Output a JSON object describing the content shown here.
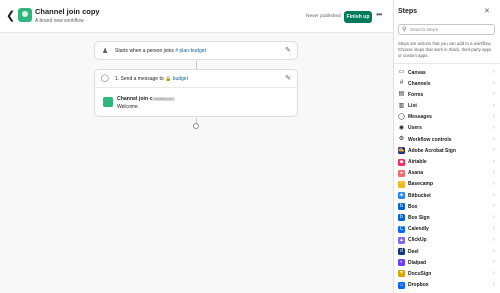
{
  "header": {
    "back_glyph": "❮",
    "title": "Channel join copy",
    "subtitle": "A brand new workflow",
    "status": "Never published",
    "finish_label": "Finish up",
    "more_glyph": "•••"
  },
  "workflow": {
    "trigger_text": "Starts when a person joins",
    "trigger_channel": "# plan-budget",
    "step_text": "1. Send a message to",
    "step_channel": "🔒 budget",
    "message": {
      "name": "Channel join copy",
      "badge": "WORKFLOW",
      "body": "Welcome"
    }
  },
  "panel": {
    "title": "Steps",
    "close_glyph": "✕",
    "search_placeholder": "Search steps",
    "description": "Steps are actions that you can add to a workflow. Choose steps that work in Slack, third-party apps or custom apps.",
    "items": [
      {
        "label": "Canvas",
        "icon": "canvas-icon",
        "glyph": "▭",
        "color": "",
        "outline": true
      },
      {
        "label": "Channels",
        "icon": "hash-icon",
        "glyph": "#",
        "color": "",
        "outline": true
      },
      {
        "label": "Forms",
        "icon": "form-icon",
        "glyph": "▤",
        "color": "",
        "outline": true
      },
      {
        "label": "List",
        "icon": "list-icon",
        "glyph": "▥",
        "color": "",
        "outline": true
      },
      {
        "label": "Messages",
        "icon": "message-icon",
        "glyph": "◯",
        "color": "",
        "outline": true
      },
      {
        "label": "Users",
        "icon": "user-icon",
        "glyph": "◉",
        "color": "",
        "outline": true
      },
      {
        "label": "Workflow controls",
        "icon": "workflow-icon",
        "glyph": "⚙",
        "color": "",
        "outline": true
      },
      {
        "label": "Adobe Acrobat Sign",
        "icon": "adobe-sign-icon",
        "glyph": "✍",
        "color": "#2d2d8c",
        "outline": false
      },
      {
        "label": "Airtable",
        "icon": "airtable-icon",
        "glyph": "◆",
        "color": "#f82b60",
        "outline": false
      },
      {
        "label": "Asana",
        "icon": "asana-icon",
        "glyph": "●",
        "color": "#f06a6a",
        "outline": false
      },
      {
        "label": "Basecamp",
        "icon": "basecamp-icon",
        "glyph": "◠",
        "color": "#e9b821",
        "outline": false
      },
      {
        "label": "Bitbucket",
        "icon": "bitbucket-icon",
        "glyph": "◈",
        "color": "#2684ff",
        "outline": false
      },
      {
        "label": "Box",
        "icon": "box-icon",
        "glyph": "b",
        "color": "#0061d5",
        "outline": false
      },
      {
        "label": "Box Sign",
        "icon": "box-sign-icon",
        "glyph": "b",
        "color": "#0061d5",
        "outline": false
      },
      {
        "label": "Calendly",
        "icon": "calendly-icon",
        "glyph": "C",
        "color": "#006bff",
        "outline": false
      },
      {
        "label": "ClickUp",
        "icon": "clickup-icon",
        "glyph": "▲",
        "color": "#7b68ee",
        "outline": false
      },
      {
        "label": "Deel",
        "icon": "deel-icon",
        "glyph": "d",
        "color": "#15357a",
        "outline": false
      },
      {
        "label": "Dialpad",
        "icon": "dialpad-icon",
        "glyph": "◐",
        "color": "#6c3dff",
        "outline": false
      },
      {
        "label": "DocuSign",
        "icon": "docusign-icon",
        "glyph": "▼",
        "color": "#d5a400",
        "outline": false
      },
      {
        "label": "Dropbox",
        "icon": "dropbox-icon",
        "glyph": "◇",
        "color": "#0061ff",
        "outline": false
      }
    ]
  }
}
